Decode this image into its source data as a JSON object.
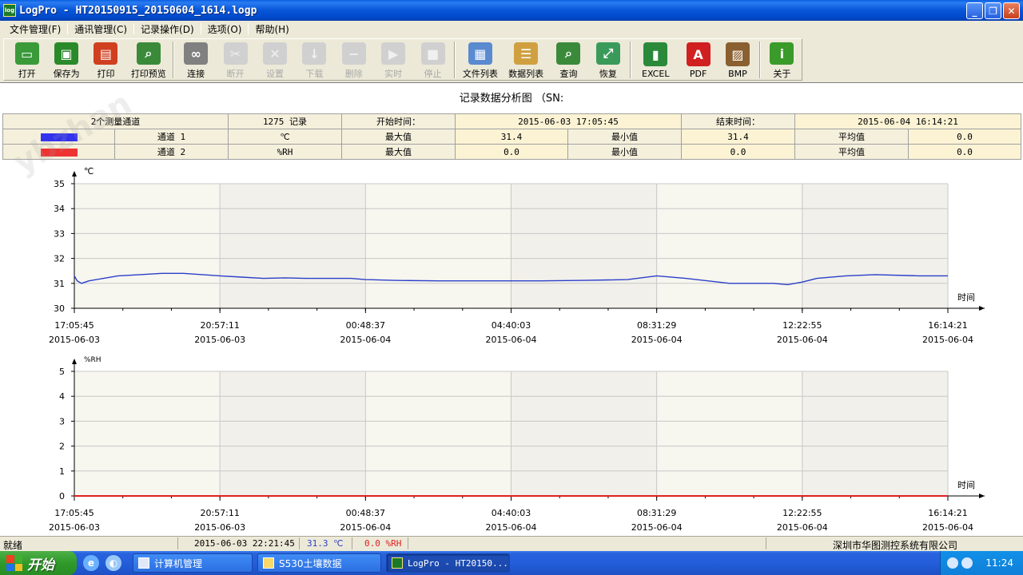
{
  "window": {
    "title": "LogPro - HT20150915_20150604_1614.logp",
    "app_icon": "log"
  },
  "menu": [
    {
      "label": "文件管理(F)"
    },
    {
      "label": "通讯管理(C)"
    },
    {
      "label": "记录操作(D)"
    },
    {
      "label": "选项(O)"
    },
    {
      "label": "帮助(H)"
    }
  ],
  "toolbar": [
    {
      "label": "打开",
      "icon": "folder-open-icon",
      "color": "#3a9a3a",
      "enabled": true
    },
    {
      "label": "保存为",
      "icon": "save-icon",
      "color": "#2a8a2a",
      "enabled": true
    },
    {
      "label": "打印",
      "icon": "printer-icon",
      "color": "#d04020",
      "enabled": true
    },
    {
      "label": "打印预览",
      "icon": "print-preview-icon",
      "color": "#3a8a3a",
      "enabled": true
    },
    {
      "label": "连接",
      "icon": "link-icon",
      "color": "#808080",
      "enabled": true
    },
    {
      "label": "断开",
      "icon": "unlink-icon",
      "color": "#c0c0c0",
      "enabled": false
    },
    {
      "label": "设置",
      "icon": "tools-icon",
      "color": "#c0c0c0",
      "enabled": false
    },
    {
      "label": "下载",
      "icon": "download-icon",
      "color": "#c0c0c0",
      "enabled": false
    },
    {
      "label": "删除",
      "icon": "delete-icon",
      "color": "#c0c0c0",
      "enabled": false
    },
    {
      "label": "实时",
      "icon": "play-icon",
      "color": "#c0c0c0",
      "enabled": false
    },
    {
      "label": "停止",
      "icon": "stop-icon",
      "color": "#c0c0c0",
      "enabled": false
    },
    {
      "label": "文件列表",
      "icon": "file-list-icon",
      "color": "#5a8ad0",
      "enabled": true
    },
    {
      "label": "数据列表",
      "icon": "data-list-icon",
      "color": "#d0a040",
      "enabled": true
    },
    {
      "label": "查询",
      "icon": "search-icon",
      "color": "#3a8a3a",
      "enabled": true
    },
    {
      "label": "恢复",
      "icon": "restore-icon",
      "color": "#3a9a5a",
      "enabled": true
    },
    {
      "label": "EXCEL",
      "icon": "excel-icon",
      "color": "#2a8a3a",
      "enabled": true
    },
    {
      "label": "PDF",
      "icon": "pdf-icon",
      "color": "#d02020",
      "enabled": true
    },
    {
      "label": "BMP",
      "icon": "bmp-icon",
      "color": "#8a6030",
      "enabled": true
    },
    {
      "label": "关于",
      "icon": "info-icon",
      "color": "#3a9a2a",
      "enabled": true
    }
  ],
  "report": {
    "title": "记录数据分析图 （SN:",
    "channels_label": "2个测量通道",
    "records_label": "1275 记录",
    "start_label": "开始时间：",
    "start_value": "2015-06-03 17:05:45",
    "end_label": "结束时间：",
    "end_value": "2015-06-04 16:14:21",
    "rows": [
      {
        "color": "#3333ee",
        "name": "通道 1",
        "unit": "℃",
        "max_label": "最大值",
        "max": "31.4",
        "min_label": "最小值",
        "min": "31.4",
        "avg_label": "平均值",
        "avg": "0.0"
      },
      {
        "color": "#ee3333",
        "name": "通道 2",
        "unit": "%RH",
        "max_label": "最大值",
        "max": "0.0",
        "min_label": "最小值",
        "min": "0.0",
        "avg_label": "平均值",
        "avg": "0.0"
      }
    ]
  },
  "chart_data": [
    {
      "type": "line",
      "ylabel": "℃",
      "xlabel": "时间",
      "ylim": [
        30,
        35
      ],
      "yticks": [
        "35",
        "34",
        "33",
        "32",
        "31",
        "30"
      ],
      "xticks": [
        {
          "time": "17:05:45",
          "date": "2015-06-03"
        },
        {
          "time": "20:57:11",
          "date": "2015-06-03"
        },
        {
          "time": "00:48:37",
          "date": "2015-06-04"
        },
        {
          "time": "04:40:03",
          "date": "2015-06-04"
        },
        {
          "time": "08:31:29",
          "date": "2015-06-04"
        },
        {
          "time": "12:22:55",
          "date": "2015-06-04"
        },
        {
          "time": "16:14:21",
          "date": "2015-06-04"
        }
      ],
      "series": [
        {
          "color": "#2b3fc8",
          "x": [
            0,
            0.02,
            0.05,
            0.1,
            0.2,
            0.3,
            0.45,
            0.6,
            0.75,
            1.0,
            1.15,
            1.3,
            1.45,
            1.6,
            1.75,
            1.9,
            2.0,
            2.2,
            2.5,
            2.8,
            3.0,
            3.2,
            3.5,
            3.8,
            4.0,
            4.2,
            4.5,
            4.8,
            4.9,
            5.0,
            5.1,
            5.3,
            5.5,
            5.8,
            6.0
          ],
          "y": [
            31.3,
            31.1,
            31.0,
            31.1,
            31.2,
            31.3,
            31.35,
            31.4,
            31.4,
            31.3,
            31.25,
            31.2,
            31.22,
            31.2,
            31.2,
            31.2,
            31.15,
            31.12,
            31.1,
            31.1,
            31.1,
            31.1,
            31.12,
            31.15,
            31.3,
            31.2,
            31.0,
            31.0,
            30.95,
            31.05,
            31.2,
            31.3,
            31.35,
            31.3,
            31.3
          ]
        }
      ]
    },
    {
      "type": "line",
      "ylabel": "%RH",
      "xlabel": "时间",
      "ylim": [
        0,
        5
      ],
      "yticks": [
        "5",
        "4",
        "3",
        "2",
        "1",
        "0"
      ],
      "xticks": [
        {
          "time": "17:05:45",
          "date": "2015-06-03"
        },
        {
          "time": "20:57:11",
          "date": "2015-06-03"
        },
        {
          "time": "00:48:37",
          "date": "2015-06-04"
        },
        {
          "time": "04:40:03",
          "date": "2015-06-04"
        },
        {
          "time": "08:31:29",
          "date": "2015-06-04"
        },
        {
          "time": "12:22:55",
          "date": "2015-06-04"
        },
        {
          "time": "16:14:21",
          "date": "2015-06-04"
        }
      ],
      "series": [
        {
          "color": "#e02020",
          "x": [
            0,
            6
          ],
          "y": [
            0,
            0
          ]
        }
      ]
    }
  ],
  "status": {
    "ready": "就绪",
    "time": "2015-06-03 22:21:45",
    "temp": "31.3 ℃",
    "temp_color": "#2b3fc8",
    "hum": "0.0 %RH",
    "hum_color": "#e02020",
    "company": "深圳市华图测控系统有限公司"
  },
  "taskbar": {
    "start": "开始",
    "tasks": [
      {
        "label": "计算机管理",
        "active": false
      },
      {
        "label": "S530土壤数据",
        "active": false
      },
      {
        "label": "LogPro - HT20150...",
        "active": true
      }
    ],
    "clock": "11:24"
  }
}
